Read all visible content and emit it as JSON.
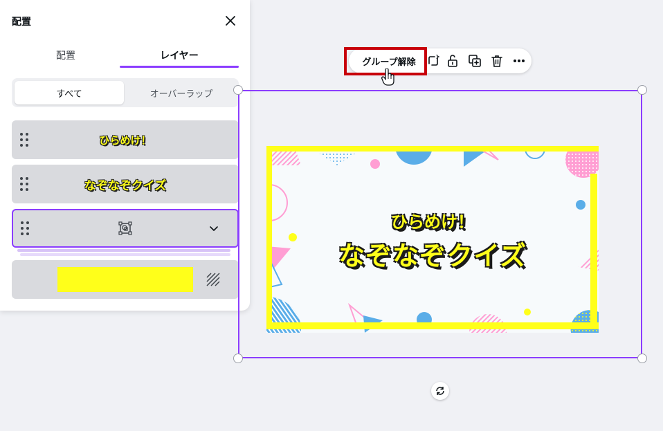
{
  "panel": {
    "title": "配置",
    "tabs": [
      {
        "label": "配置"
      },
      {
        "label": "レイヤー"
      }
    ],
    "filters": [
      {
        "label": "すべて"
      },
      {
        "label": "オーバーラップ"
      }
    ],
    "layers": [
      {
        "text": "ひらめけ！"
      },
      {
        "text": "なぞなぞクイズ"
      }
    ],
    "background_color": "#ffff1a"
  },
  "toolbar": {
    "ungroup_label": "グループ解除"
  },
  "canvas": {
    "title_line1": "ひらめけ！",
    "title_line2": "なぞなぞクイズ"
  },
  "colors": {
    "accent": "#8b3dff",
    "highlight": "#c8000a",
    "quiz_yellow": "#ffff1a",
    "quiz_blue": "#5aade8",
    "quiz_pink": "#ff9ed3"
  }
}
